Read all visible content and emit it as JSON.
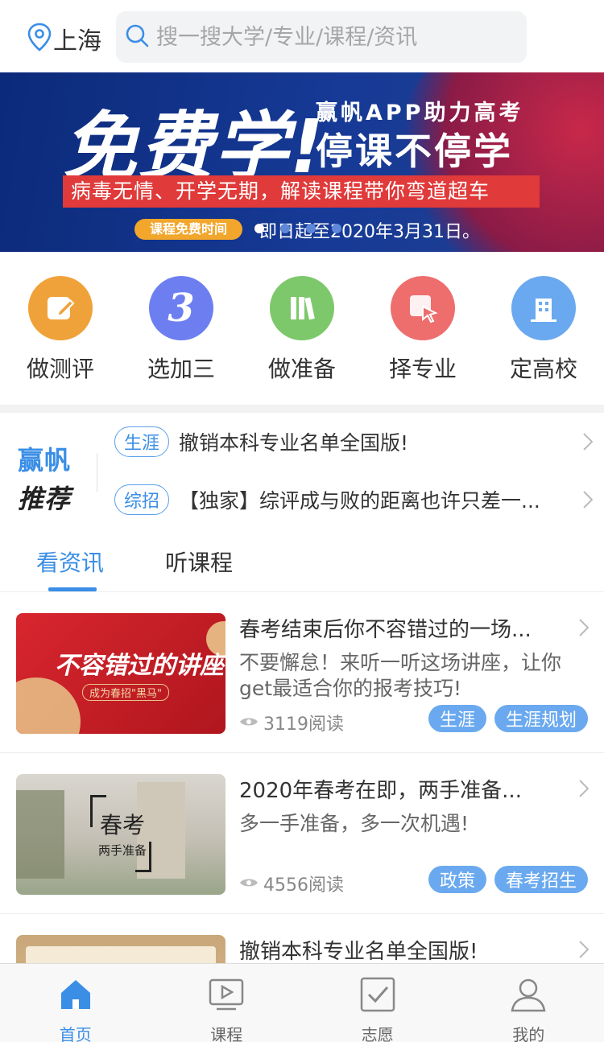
{
  "header": {
    "location": "上海",
    "search_placeholder": "搜一搜大学/专业/课程/资讯"
  },
  "banner": {
    "headline": "免费学!",
    "sub_line1": "赢帆APP助力高考",
    "sub_line2": "停课不停学",
    "strip": "病毒无情、开学无期，解读课程带你弯道超车",
    "pill": "课程免费时间",
    "date": "即日起至2020年3月31日。",
    "dots": 4,
    "active_dot": 0
  },
  "quick_actions": [
    {
      "label": "做测评",
      "icon": "edit-icon",
      "color": "#f0a23a"
    },
    {
      "label": "选加三",
      "icon": "number-three-icon",
      "color": "#6d7ff0"
    },
    {
      "label": "做准备",
      "icon": "books-icon",
      "color": "#7dc86a"
    },
    {
      "label": "择专业",
      "icon": "cursor-select-icon",
      "color": "#ee6e6e"
    },
    {
      "label": "定高校",
      "icon": "building-icon",
      "color": "#6aa9ef"
    }
  ],
  "recommend": {
    "logo_line1": "赢帆",
    "logo_line2": "推荐",
    "items": [
      {
        "tag": "生涯",
        "title": "撤销本科专业名单全国版!"
      },
      {
        "tag": "综招",
        "title": "【独家】综评成与败的距离也许只差一..."
      }
    ]
  },
  "tabs": [
    {
      "label": "看资讯",
      "active": true
    },
    {
      "label": "听课程",
      "active": false
    }
  ],
  "articles": [
    {
      "title": "春考结束后你不容错过的一场...",
      "desc": "不要懈怠！来听一听这场讲座，让你get最适合你的报考技巧!",
      "reads": "3119阅读",
      "tags": [
        "生涯",
        "生涯规划"
      ],
      "thumb_text": "不容错过的讲座",
      "thumb_sub": "成为春招\"黑马\""
    },
    {
      "title": "2020年春考在即，两手准备...",
      "desc": "多一手准备，多一次机遇!",
      "reads": "4556阅读",
      "tags": [
        "政策",
        "春考招生"
      ],
      "thumb_text": "春考",
      "thumb_sub": "两手准备"
    },
    {
      "title": "撤销本科专业名单全国版!",
      "desc": "",
      "reads": "",
      "tags": []
    }
  ],
  "bottom_nav": [
    {
      "label": "首页",
      "icon": "home-icon",
      "active": true
    },
    {
      "label": "课程",
      "icon": "video-play-icon",
      "active": false
    },
    {
      "label": "志愿",
      "icon": "checkbox-icon",
      "active": false
    },
    {
      "label": "我的",
      "icon": "user-icon",
      "active": false
    }
  ],
  "colors": {
    "accent": "#3a8ee6",
    "banner_bg": "#163a96",
    "strip_red": "#e03a3a",
    "tag_blue": "#6aa9ef"
  }
}
